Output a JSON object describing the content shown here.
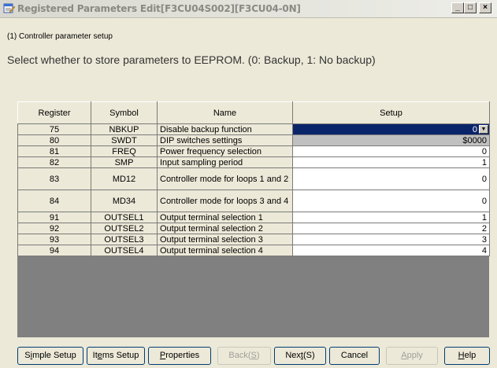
{
  "window": {
    "title": "Registered Parameters Edit[F3CU04S002][F3CU04-0N]",
    "controls": [
      "_",
      "□",
      "×"
    ]
  },
  "section_label": "(1) Controller parameter setup",
  "instruction": "Select whether to store parameters to EEPROM. (0: Backup, 1: No backup)",
  "table": {
    "headers": [
      "Register",
      "Symbol",
      "Name",
      "Setup"
    ],
    "rows": [
      {
        "register": "75",
        "symbol": "NBKUP",
        "name": "Disable backup function",
        "setup": "0"
      },
      {
        "register": "80",
        "symbol": "SWDT",
        "name": "DIP switches settings",
        "setup": "$0000"
      },
      {
        "register": "81",
        "symbol": "FREQ",
        "name": "Power frequency selection",
        "setup": "0"
      },
      {
        "register": "82",
        "symbol": "SMP",
        "name": "Input sampling period",
        "setup": "1"
      },
      {
        "register": "83",
        "symbol": "MD12",
        "name": "Controller mode for loops 1 and 2",
        "setup": "0"
      },
      {
        "register": "84",
        "symbol": "MD34",
        "name": "Controller mode for loops 3 and 4",
        "setup": "0"
      },
      {
        "register": "91",
        "symbol": "OUTSEL1",
        "name": "Output terminal selection 1",
        "setup": "1"
      },
      {
        "register": "92",
        "symbol": "OUTSEL2",
        "name": "Output terminal selection 2",
        "setup": "2"
      },
      {
        "register": "93",
        "symbol": "OUTSEL3",
        "name": "Output terminal selection 3",
        "setup": "3"
      },
      {
        "register": "94",
        "symbol": "OUTSEL4",
        "name": "Output terminal selection 4",
        "setup": "4"
      }
    ]
  },
  "buttons": {
    "simple_setup": {
      "pre": "S",
      "u": "i",
      "post": "mple Setup"
    },
    "items_setup": {
      "pre": "It",
      "u": "e",
      "post": "ms Setup"
    },
    "properties": {
      "pre": "",
      "u": "P",
      "post": "roperties"
    },
    "back": {
      "pre": "Back(",
      "u": "S",
      "post": ")"
    },
    "next": {
      "pre": "Nex",
      "u": "t",
      "post": "(S)"
    },
    "cancel": {
      "pre": "Cancel",
      "u": "",
      "post": ""
    },
    "apply": {
      "pre": "",
      "u": "A",
      "post": "pply"
    },
    "help": {
      "pre": "",
      "u": "H",
      "post": "elp"
    }
  }
}
